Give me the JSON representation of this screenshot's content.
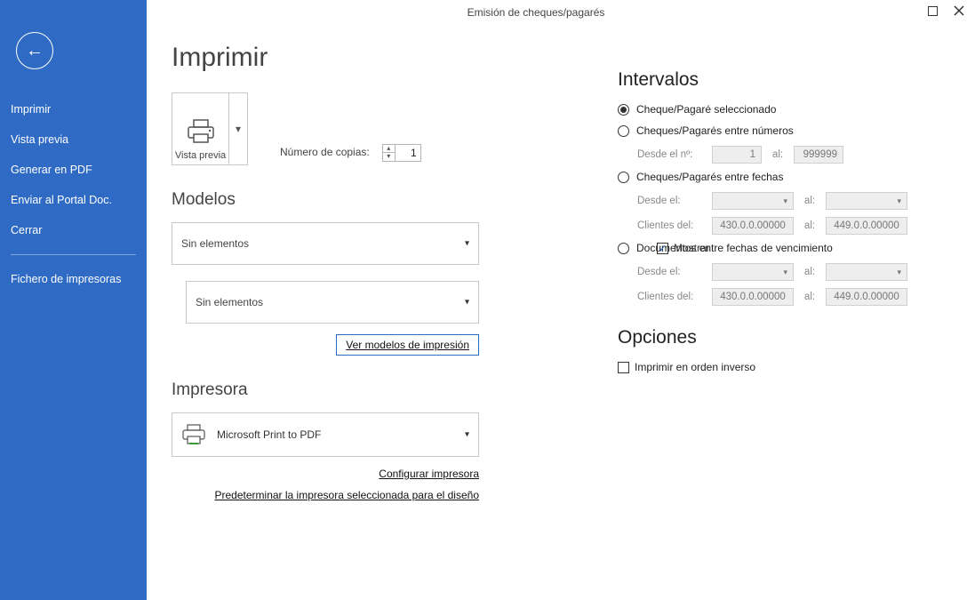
{
  "window_title": "Emisión de cheques/pagarés",
  "page_title": "Imprimir",
  "sidebar": {
    "items": [
      "Imprimir",
      "Vista previa",
      "Generar en PDF",
      "Enviar al Portal Doc.",
      "Cerrar"
    ],
    "secondary": [
      "Fichero de impresoras"
    ]
  },
  "preview_btn": "Vista previa",
  "copies_label": "Número de copias:",
  "copies_value": "1",
  "modelos": {
    "heading": "Modelos",
    "mostrar_label": "Mostrar",
    "mostrar_checked": true,
    "combo1": "Sin elementos",
    "combo2": "Sin elementos",
    "link": "Ver modelos de impresión"
  },
  "impresora": {
    "heading": "Impresora",
    "name": "Microsoft Print to PDF",
    "link1": "Configurar impresora",
    "link2": "Predeterminar la impresora seleccionada para el diseño"
  },
  "intervalos": {
    "heading": "Intervalos",
    "r1": "Cheque/Pagaré seleccionado",
    "r2": "Cheques/Pagarés entre números",
    "r2_from_lbl": "Desde el nº:",
    "r2_from": "1",
    "r2_to_lbl": "al:",
    "r2_to": "999999",
    "r3": "Cheques/Pagarés entre fechas",
    "r3_from_lbl": "Desde el:",
    "r3_to_lbl": "al:",
    "r3_cli_lbl": "Clientes del:",
    "r3_cli_from": "430.0.0.00000",
    "r3_cli_to_lbl": "al:",
    "r3_cli_to": "449.0.0.00000",
    "r4": "Documentos entre fechas de vencimiento",
    "r4_from_lbl": "Desde el:",
    "r4_to_lbl": "al:",
    "r4_cli_lbl": "Clientes del:",
    "r4_cli_from": "430.0.0.00000",
    "r4_cli_to_lbl": "al:",
    "r4_cli_to": "449.0.0.00000"
  },
  "opciones": {
    "heading": "Opciones",
    "chk1": "Imprimir en orden inverso"
  }
}
